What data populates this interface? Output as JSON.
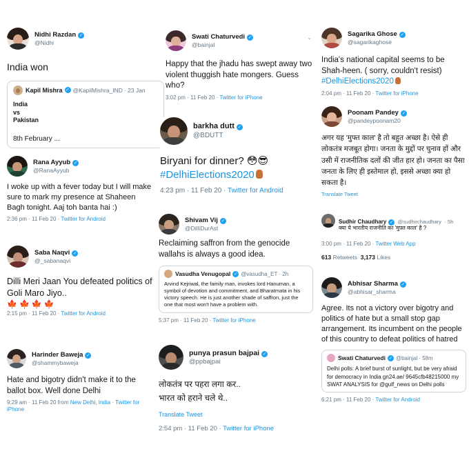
{
  "tweets": {
    "nidhi": {
      "name": "Nidhi Razdan",
      "handle": "@Nidhi",
      "text": "India won",
      "quote": {
        "name": "Kapil Mishra",
        "handle": "@KapilMishra_IND",
        "time": "· 23 Jan",
        "line1": "India",
        "line2": "vs",
        "line3": "Pakistan",
        "line4": "8th February ..."
      }
    },
    "swati1": {
      "name": "Swati Chaturvedi",
      "handle": "@bainjal",
      "text": "Happy that the jhadu has swept away two violent thuggish hate mongers. Guess who?",
      "meta": "3:02 pm · 11 Feb 20 · ",
      "source": "Twitter for iPhone"
    },
    "sagarika": {
      "name": "Sagarika Ghose",
      "handle": "@sagarikaghose",
      "text": "India's national capital seems to be Shah-heen. ( sorry, couldn't resist)",
      "hashtag": "#DelhiElections2020",
      "meta": "2:04 pm · 11 Feb 20 · ",
      "source": "Twitter for iPhone"
    },
    "barkha": {
      "name": "barkha dutt",
      "handle": "@BDUTT",
      "text": "Biryani for dinner? 😳😎",
      "hashtag": "#DelhiElections2020",
      "meta": "4:23 pm · 11 Feb 20 · ",
      "source": "Twitter for Android"
    },
    "poonam": {
      "name": "Poonam Pandey",
      "handle": "@pandeypoonam20",
      "text": "अगर यह 'मुफ्त काल' है तो बहुत अच्छा है। ऐसे ही लोकतंत्र मजबूत होगा। जनता के मुद्दों पर चुनाव हों और उसी में राजनीतिक दलों की जीत हार हो। जनता का पैसा जनता के लिए ही इस्तेमाल हो, इससे अच्छा क्या हो सकता है।",
      "translate": "Translate Tweet"
    },
    "rana": {
      "name": "Rana Ayyub",
      "handle": "@RanaAyyub",
      "text": "I woke up with a fever today but I will make sure to mark my presence at Shaheen Bagh tonight. Aaj toh banta hai :)",
      "meta": "2:36 pm · 11 Feb 20 · ",
      "source": "Twitter for Android"
    },
    "shivam": {
      "name": "Shivam Vij",
      "handle": "@DilliDurAst",
      "text": "Reclaiming saffron from the genocide wallahs is always a good idea.",
      "quote": {
        "name": "Vasudha Venugopal",
        "handle": "@vasudha_ET",
        "time": "· 2h",
        "text": "Arvind Kejriwal, the family man, invokes lord Hanuman, a symbol of devotion and commitment, and Bharatmata in his victory speech. He is just another shade of saffron, just the one that most won't have a problem with."
      },
      "meta": "5:37 pm · 11 Feb 20 · ",
      "source": "Twitter for iPhone"
    },
    "sudhir": {
      "name": "Sudhir Chaudhary",
      "handle": "@sudhirchaudhary",
      "time": "· 5h",
      "text": "क्या ये भारतीय राजनीति का 'मुफ़्त काल' है ?",
      "meta": "3:00 pm · 11 Feb 20 · ",
      "source": "Twitter Web App",
      "retweets": "613",
      "retweets_label": "Retweets",
      "likes": "3,173",
      "likes_label": "Likes"
    },
    "saba": {
      "name": "Saba Naqvi",
      "handle": "@_sabanaqvi",
      "text": "Dilli Meri Jaan You defeated politics of Goli Maro Jiyo..",
      "flags": "🍁🍁🍁🍁",
      "meta": "2:15 pm · 11 Feb 20 · ",
      "source": "Twitter for Android"
    },
    "abhisar": {
      "name": "Abhisar Sharma",
      "handle": "@abhisar_sharma",
      "text": "Agree.  Its not a victory over bigotry and politics of hate but a small stop gap arrangement. Its incumbent on the people of this country to defeat politics of hatred",
      "quote": {
        "name": "Swati Chaturvedi",
        "handle": "@bainjal",
        "time": "· 58m",
        "text": "Delhi polls: A brief burst of sunlight, but be very afraid for democracy in India gn24.ae/ 9645cfb48215000 my SWAT ANALYSIS for @gulf_news on Delhi polls"
      },
      "meta": "6:21 pm · 11 Feb 20 · ",
      "source": "Twitter for Android"
    },
    "harinder": {
      "name": "Harinder Baweja",
      "handle": "@shammybaweja",
      "text": "Hate and bigotry didn't make it to the ballot box. Well done Delhi",
      "meta": "9:29 am · 11 Feb 20 from ",
      "location": "New Delhi, India",
      "sep": " · ",
      "source": "Twitter for iPhone"
    },
    "punya": {
      "name": "punya prasun bajpai",
      "handle": "@ppbajpai",
      "text1": "लोकतंत्र पर पहरा लगा कर..",
      "text2": "भारत को हराने चले थे..",
      "translate": "Translate Tweet",
      "meta": "2:54 pm · 11 Feb 20 · ",
      "source": "Twitter for iPhone"
    }
  },
  "verified_glyph": "✓",
  "caret_glyph": "⌄",
  "colors": {
    "link": "#1b95e0",
    "muted": "#657786",
    "verified": "#1da1f2"
  }
}
